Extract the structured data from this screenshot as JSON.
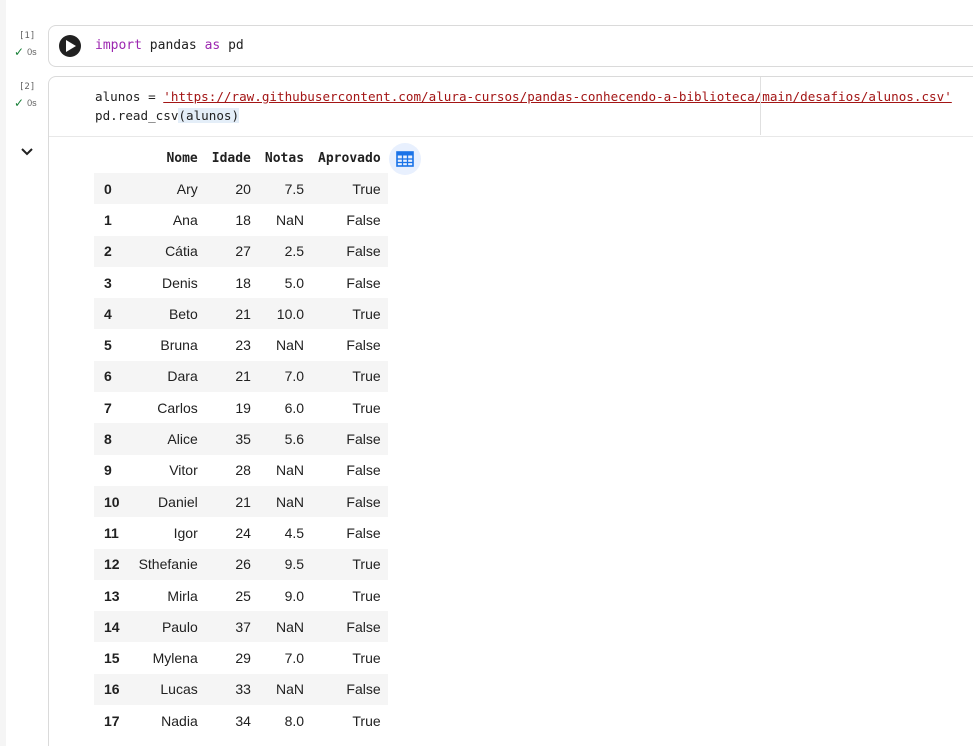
{
  "cells": [
    {
      "exec_count": "[1]",
      "status": "0s",
      "code": {
        "keyword_import": "import",
        "module": " pandas ",
        "keyword_as": "as",
        "alias": " pd"
      }
    },
    {
      "exec_count": "[2]",
      "status": "0s",
      "code": {
        "line1_prefix": "alunos = ",
        "line1_string": "'https://raw.githubusercontent.com/alura-cursos/pandas-conhecendo-a-biblioteca/main/desafios/alunos.csv'",
        "line2_prefix": "pd.read_csv",
        "line2_args": "(alunos)"
      }
    }
  ],
  "icons": {
    "run": "play-icon",
    "status": "check-icon",
    "collapse": "chevron-down-icon",
    "table": "table-icon"
  },
  "table": {
    "columns": [
      "",
      "Nome",
      "Idade",
      "Notas",
      "Aprovado"
    ],
    "rows": [
      [
        "0",
        "Ary",
        "20",
        "7.5",
        "True"
      ],
      [
        "1",
        "Ana",
        "18",
        "NaN",
        "False"
      ],
      [
        "2",
        "Cátia",
        "27",
        "2.5",
        "False"
      ],
      [
        "3",
        "Denis",
        "18",
        "5.0",
        "False"
      ],
      [
        "4",
        "Beto",
        "21",
        "10.0",
        "True"
      ],
      [
        "5",
        "Bruna",
        "23",
        "NaN",
        "False"
      ],
      [
        "6",
        "Dara",
        "21",
        "7.0",
        "True"
      ],
      [
        "7",
        "Carlos",
        "19",
        "6.0",
        "True"
      ],
      [
        "8",
        "Alice",
        "35",
        "5.6",
        "False"
      ],
      [
        "9",
        "Vitor",
        "28",
        "NaN",
        "False"
      ],
      [
        "10",
        "Daniel",
        "21",
        "NaN",
        "False"
      ],
      [
        "11",
        "Igor",
        "24",
        "4.5",
        "False"
      ],
      [
        "12",
        "Sthefanie",
        "26",
        "9.5",
        "True"
      ],
      [
        "13",
        "Mirla",
        "25",
        "9.0",
        "True"
      ],
      [
        "14",
        "Paulo",
        "37",
        "NaN",
        "False"
      ],
      [
        "15",
        "Mylena",
        "29",
        "7.0",
        "True"
      ],
      [
        "16",
        "Lucas",
        "33",
        "NaN",
        "False"
      ],
      [
        "17",
        "Nadia",
        "34",
        "8.0",
        "True"
      ]
    ]
  }
}
